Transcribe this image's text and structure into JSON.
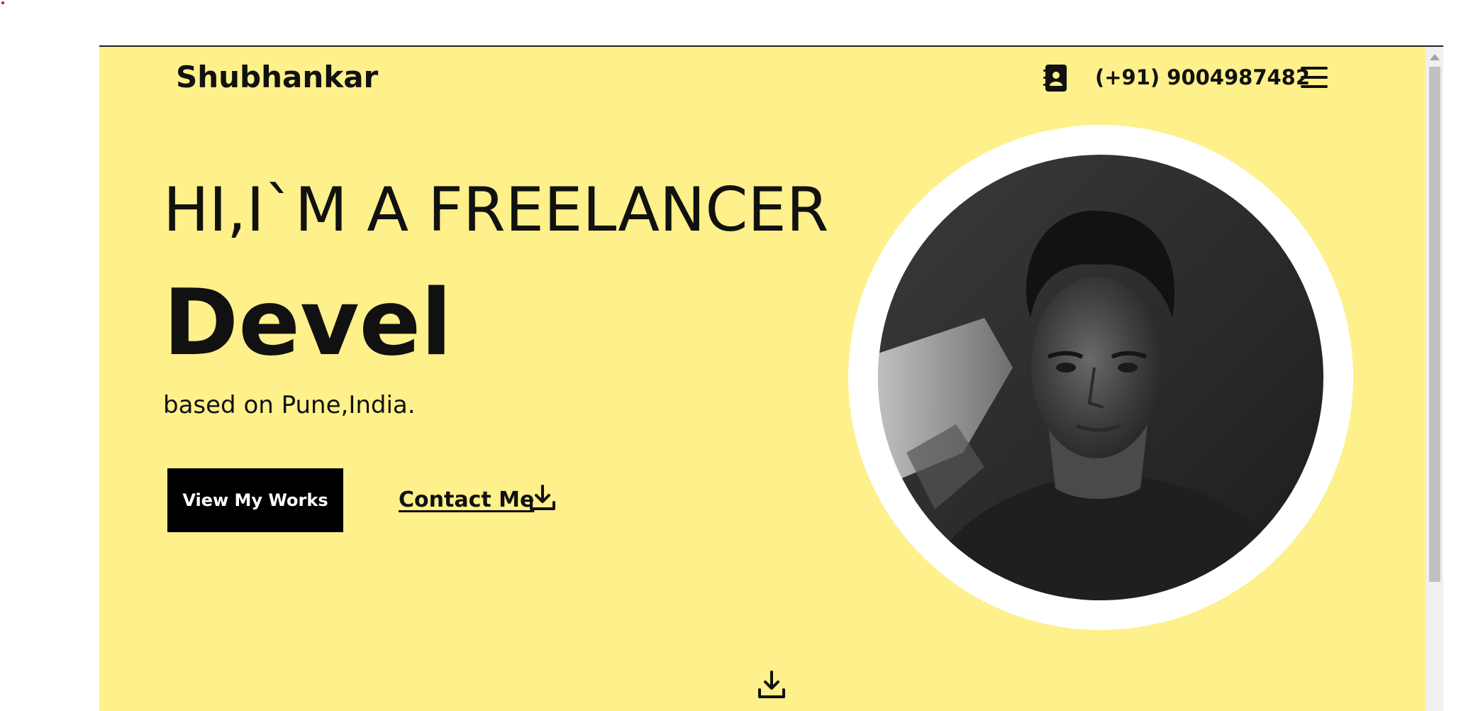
{
  "header": {
    "logo": "Shubhankar",
    "phone": "(+91) 9004987482",
    "contact_icon": "contact-book-icon",
    "menu_icon": "hamburger-menu-icon"
  },
  "hero": {
    "headline": "HI,I`M A FREELANCER",
    "role": "Devel",
    "location": "based on Pune,India.",
    "primary_button": "View My Works",
    "contact_link": "Contact Me",
    "contact_link_icon": "download-icon",
    "scroll_icon": "download-icon",
    "photo": "profile-photo"
  },
  "colors": {
    "page_background": "#fef08a",
    "text": "#111111",
    "button_background": "#000000",
    "button_text": "#ffffff",
    "ring": "#ffffff"
  }
}
